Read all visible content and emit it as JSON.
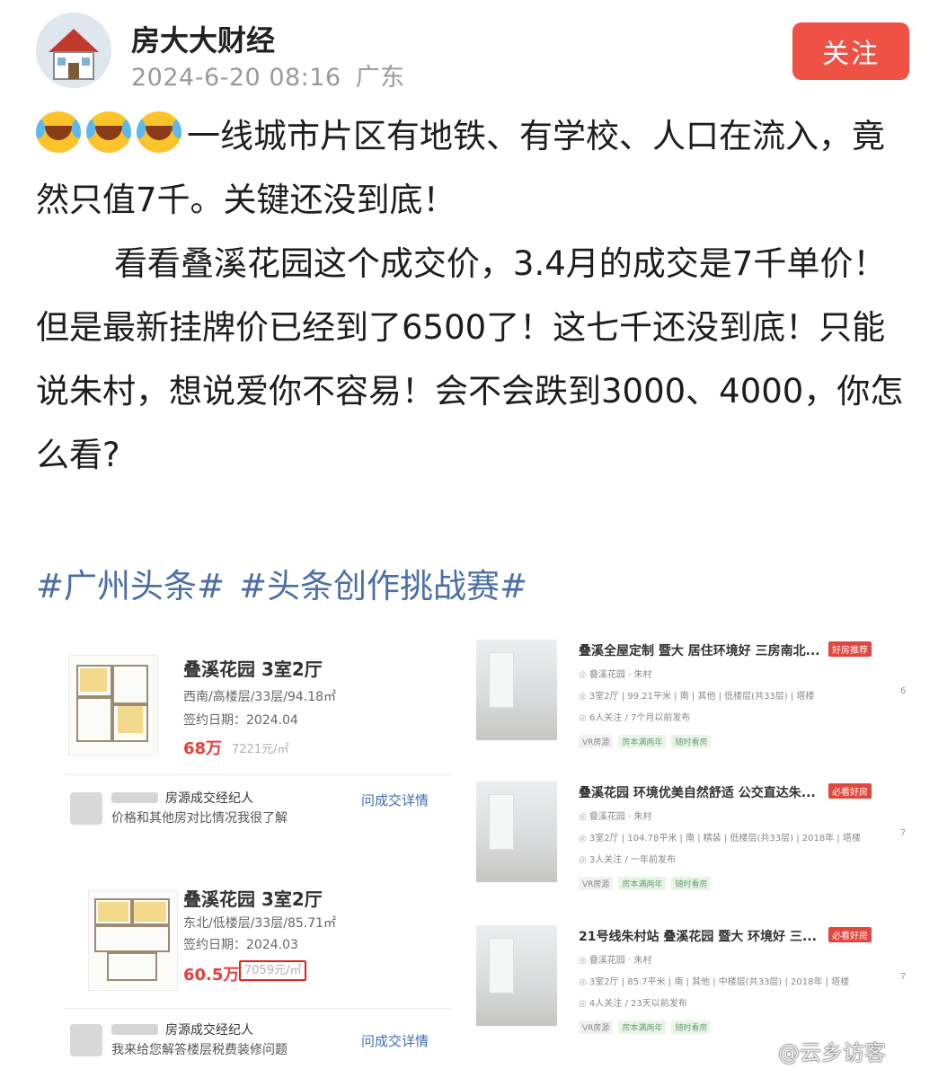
{
  "post": {
    "author": "房大大财经",
    "date": "2024-6-20 08:16",
    "location": "广东",
    "follow_label": "关注",
    "emoji_icon": "laugh-cry-emoji",
    "line1": "一线城市片区有地铁、有学校、人口在流入，竟然只值7千。关键还没到底！",
    "line2": "看看叠溪花园这个成交价，3.4月的成交是7千单价！但是最新挂牌价已经到了6500了！这七千还没到底！只能说朱村，想说爱你不容易！会不会跌到3000、4000，你怎么看?",
    "tags": [
      "#广州头条#",
      "#头条创作挑战赛#"
    ]
  },
  "screenshot": {
    "deals": [
      {
        "title": "叠溪花园 3室2厅",
        "info": "西南/高楼层/33层/94.18㎡",
        "date_label": "签约日期：",
        "date": "2024.04",
        "price": "68万",
        "unit_price": "7221元/㎡"
      },
      {
        "title": "叠溪花园 3室2厅",
        "info": "东北/低楼层/33层/85.71㎡",
        "date_label": "签约日期：",
        "date": "2024.03",
        "price": "60.5万",
        "unit_price": "7059元/㎡"
      }
    ],
    "agents": [
      {
        "role": "房源成交经纪人",
        "desc": "价格和其他房对比情况我很了解",
        "ask": "问成交详情"
      },
      {
        "role": "房源成交经纪人",
        "desc": "我来给您解答楼层税费装修问题",
        "ask": "问成交详情"
      }
    ],
    "listings": [
      {
        "title": "叠溪全屋定制 暨大 居住环境好 三房南北...",
        "badge": "好房推荐",
        "area": "叠溪花园 · 朱村",
        "detail": "3室2厅 | 99.21平米 | 南 | 其他 | 低楼层(共33层) | 塔楼",
        "followers": "6人关注 / 7个月以前发布",
        "tags": [
          "VR房源",
          "房本满两年",
          "随时看房"
        ],
        "num": "6"
      },
      {
        "title": "叠溪花园 环境优美自然舒适 公交直达朱...",
        "badge": "必看好房",
        "area": "叠溪花园 · 朱村",
        "detail": "3室2厅 | 104.78平米 | 南 | 精装 | 低楼层(共33层) | 2018年 | 塔楼",
        "followers": "3人关注 / 一年前发布",
        "tags": [
          "VR房源",
          "房本满两年",
          "随时看房"
        ],
        "num": "7"
      },
      {
        "title": "21号线朱村站 叠溪花园 暨大 环境好 三...",
        "badge": "必看好房",
        "area": "叠溪花园 · 朱村",
        "detail": "3室2厅 | 85.7平米 | 南 | 其他 | 中楼层(共33层) | 2018年 | 塔楼",
        "followers": "4人关注 / 23天以前发布",
        "tags": [
          "VR房源",
          "房本满两年",
          "随时看房"
        ],
        "num": "7"
      }
    ]
  },
  "watermark": "@云乡访客",
  "colors": {
    "follow_bg": "#ef5145",
    "tag": "#4a6ea6",
    "price": "#e3403b",
    "highlight": "#e0221e"
  }
}
